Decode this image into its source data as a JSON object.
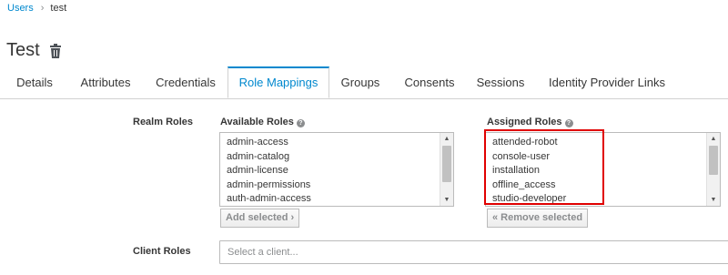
{
  "breadcrumb": {
    "parent": "Users",
    "separator": "›",
    "current": "test"
  },
  "page": {
    "title": "Test",
    "delete_icon": "trash-icon"
  },
  "tabs": [
    {
      "label": "Details"
    },
    {
      "label": "Attributes"
    },
    {
      "label": "Credentials"
    },
    {
      "label": "Role Mappings",
      "active": true
    },
    {
      "label": "Groups"
    },
    {
      "label": "Consents"
    },
    {
      "label": "Sessions"
    },
    {
      "label": "Identity Provider Links"
    }
  ],
  "realm_roles": {
    "label": "Realm Roles",
    "available": {
      "heading": "Available Roles",
      "help_icon": "question-circle-icon",
      "items": [
        "admin-access",
        "admin-catalog",
        "admin-license",
        "admin-permissions",
        "auth-admin-access"
      ],
      "button": "Add selected ›"
    },
    "assigned": {
      "heading": "Assigned Roles",
      "help_icon": "question-circle-icon",
      "items": [
        "attended-robot",
        "console-user",
        "installation",
        "offline_access",
        "studio-developer"
      ],
      "button": "« Remove selected"
    }
  },
  "client_roles": {
    "label": "Client Roles",
    "placeholder": "Select a client..."
  },
  "colors": {
    "accent": "#0088ce",
    "highlight": "#e00000",
    "text": "#363636"
  }
}
